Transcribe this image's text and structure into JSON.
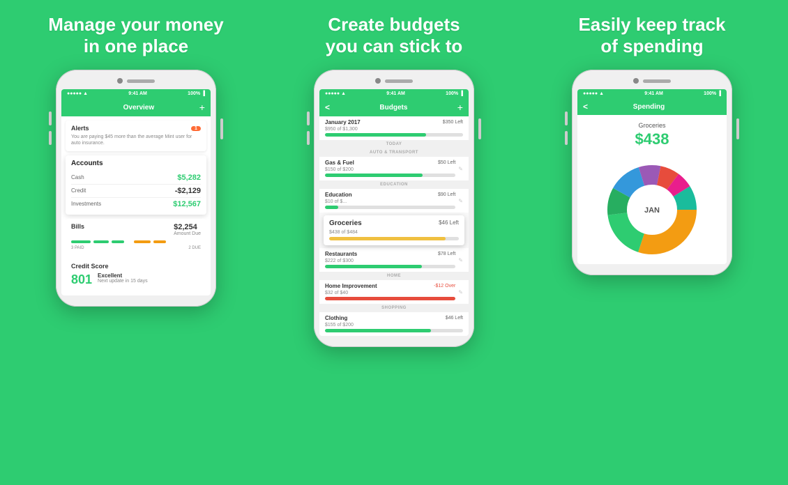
{
  "panels": [
    {
      "title_line1": "Manage your money",
      "title_line2": "in one place",
      "status": {
        "signal": "•••••",
        "wifi": "WiFi",
        "time": "9:41 AM",
        "battery": "100%"
      },
      "nav": {
        "title": "Overview",
        "action": "+"
      },
      "alert": {
        "title": "Alerts",
        "badge": "1",
        "text": "You are paying $45 more than the average Mint user for auto insurance."
      },
      "accounts": {
        "title": "Accounts",
        "rows": [
          {
            "name": "Cash",
            "value": "$5,282",
            "type": "green"
          },
          {
            "name": "Credit",
            "value": "-$2,129",
            "type": "neg"
          },
          {
            "name": "Investments",
            "value": "$12,567",
            "type": "green"
          }
        ]
      },
      "bills": {
        "title": "Bills",
        "amount": "$2,254",
        "due": "Amount Due",
        "paid_label": "3 PAID",
        "due_label": "2 DUE"
      },
      "credit": {
        "title": "Credit Score",
        "score": "801",
        "label": "Excellent",
        "sub": "Next update in 15 days"
      }
    },
    {
      "title_line1": "Create budgets",
      "title_line2": "you can stick to",
      "status": {
        "time": "9:41 AM",
        "battery": "100%"
      },
      "nav": {
        "title": "Budgets",
        "back": "<",
        "action": "+"
      },
      "budget_month": "January 2017",
      "budget_month_left": "$350 Left",
      "budget_month_sub": "$950 of $1,300",
      "section1": "TODAY",
      "section2": "AUTO & TRANSPORT",
      "gas": {
        "name": "Gas & Fuel",
        "left": "$50 Left",
        "sub": "$150 of $200",
        "pct": 75
      },
      "section3": "EDUCATION",
      "education": {
        "name": "Education",
        "left": "$90 Left",
        "sub": "$10 of $...",
        "pct": 10
      },
      "grocery_card": {
        "name": "Groceries",
        "left": "$46 Left",
        "sub": "$438 of $484",
        "pct": 90,
        "type": "yellow"
      },
      "section4": "HOME",
      "restaurants": {
        "name": "Restaurants",
        "left": "$78 Left",
        "sub": "$222 of $300",
        "pct": 74
      },
      "home_improvement": {
        "name": "Home Improvement",
        "left": "-$12 Over",
        "sub": "$32 of $40",
        "pct": 100,
        "type": "red"
      },
      "section5": "SHOPPING",
      "clothing": {
        "name": "Clothing",
        "left": "$46 Left",
        "sub": "$155 of $200",
        "pct": 77
      }
    },
    {
      "title_line1": "Easily keep track",
      "title_line2": "of spending",
      "status": {
        "time": "9:41 AM",
        "battery": "100%"
      },
      "nav": {
        "title": "Spending",
        "back": "<"
      },
      "category": "Groceries",
      "amount": "$438",
      "month_label": "JAN",
      "chart_segments": [
        {
          "color": "#f39c12",
          "value": 30
        },
        {
          "color": "#2ecc71",
          "value": 18
        },
        {
          "color": "#27ae60",
          "value": 10
        },
        {
          "color": "#3498db",
          "value": 12
        },
        {
          "color": "#9b59b6",
          "value": 8
        },
        {
          "color": "#e74c3c",
          "value": 7
        },
        {
          "color": "#e91e8c",
          "value": 6
        },
        {
          "color": "#1abc9c",
          "value": 9
        }
      ]
    }
  ]
}
